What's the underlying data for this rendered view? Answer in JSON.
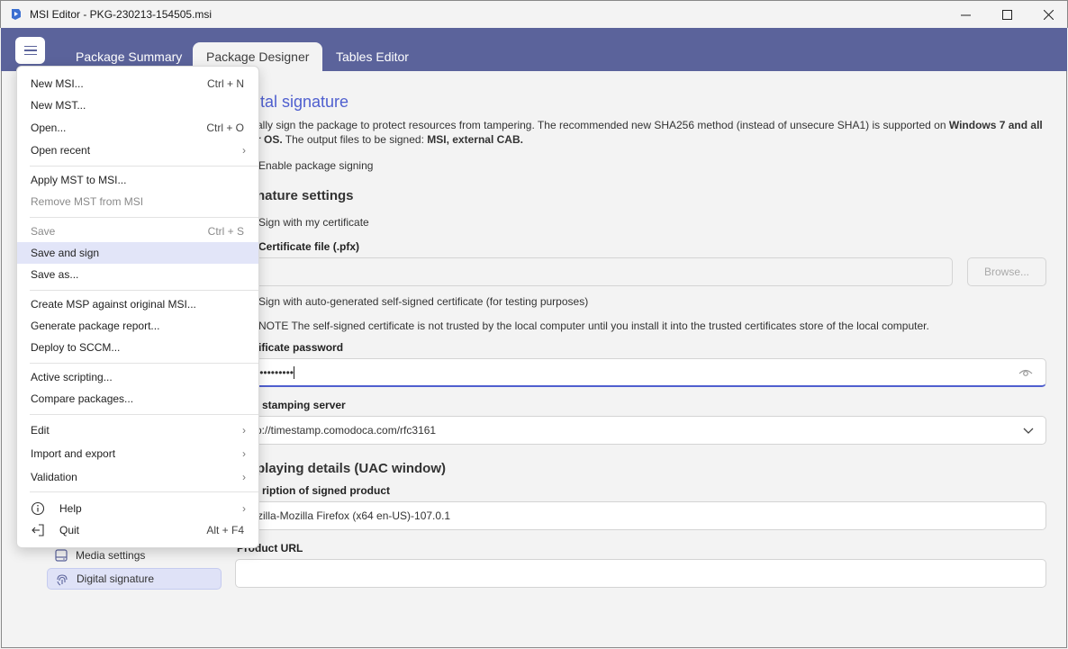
{
  "window": {
    "title": "MSI Editor - PKG-230213-154505.msi"
  },
  "tabs": [
    {
      "label": "Package Summary"
    },
    {
      "label": "Package Designer"
    },
    {
      "label": "Tables Editor"
    }
  ],
  "page": {
    "title_visible": "ital signature",
    "description_line1": "ally sign the package to protect resources from tampering. The recommended new SHA256 method (instead of unsecure SHA1) is supported on ",
    "description_bold1": "Windows 7 and all",
    "description_line2_bold": "r OS.",
    "description_line2": " The output files to be signed: ",
    "description_bold2": "MSI, external CAB.",
    "enable_signing": "Enable package signing",
    "signature_settings": "nature settings",
    "sign_with_cert": "Sign with my certificate",
    "cert_file_label": "Certificate file (.pfx)",
    "browse_label": "Browse...",
    "sign_self_signed": "Sign with auto-generated self-signed certificate (for testing purposes)",
    "note": "NOTE The self-signed certificate is not trusted by the local computer until you install it into the trusted certificates store of the local computer.",
    "cert_password_label": "ificate password",
    "password_value": "••••••••••",
    "timestamp_label": "stamping server",
    "timestamp_value": "o://timestamp.comodoca.com/rfc3161",
    "displaying_details": "playing details (UAC window)",
    "desc_product_label": "ription of signed product",
    "desc_product_value": "zilla-Mozilla Firefox (x64 en-US)-107.0.1",
    "product_url_label": "Product URL",
    "product_url_value": ""
  },
  "sidebar": {
    "items": [
      {
        "label": "Media settings",
        "icon": "media-icon"
      },
      {
        "label": "Digital signature",
        "icon": "fingerprint-icon",
        "active": true
      }
    ]
  },
  "menu": {
    "items": [
      {
        "label": "New MSI...",
        "shortcut": "Ctrl + N"
      },
      {
        "label": "New MST..."
      },
      {
        "label": "Open...",
        "shortcut": "Ctrl + O"
      },
      {
        "label": "Open recent",
        "submenu": true
      },
      {
        "label": "Apply MST to MSI..."
      },
      {
        "label": "Remove MST from MSI",
        "disabled": true
      },
      {
        "label": "Save",
        "shortcut": "Ctrl + S",
        "disabled": true
      },
      {
        "label": "Save and sign",
        "highlighted": true
      },
      {
        "label": "Save as..."
      },
      {
        "label": "Create MSP against original MSI..."
      },
      {
        "label": "Generate package report..."
      },
      {
        "label": "Deploy to SCCM..."
      },
      {
        "label": "Active scripting..."
      },
      {
        "label": "Compare packages..."
      },
      {
        "label": "Edit",
        "submenu": true
      },
      {
        "label": "Import and export",
        "submenu": true
      },
      {
        "label": "Validation",
        "submenu": true
      },
      {
        "label": "Help",
        "submenu": true,
        "icon": "info-icon"
      },
      {
        "label": "Quit",
        "shortcut": "Alt + F4",
        "icon": "exit-icon"
      }
    ],
    "arrow": "›"
  },
  "colors": {
    "header": "#5b639b",
    "accent": "#4f5fcf",
    "highlight": "#e2e5f8"
  }
}
